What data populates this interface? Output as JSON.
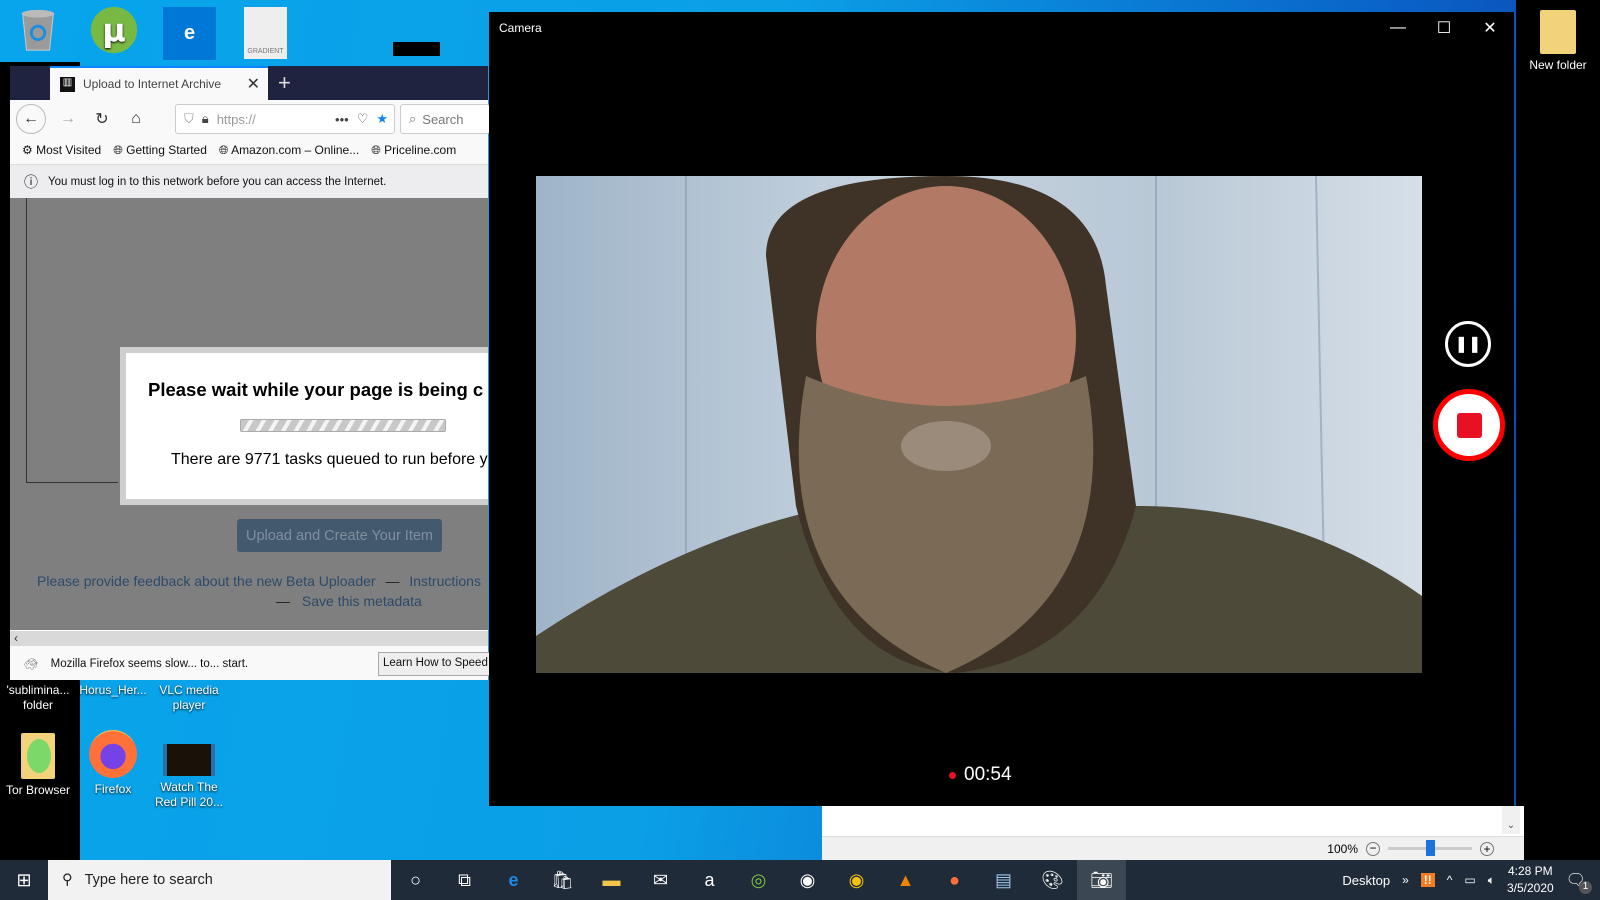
{
  "desktop": {
    "top_icons": [
      {
        "name": "recycle-bin",
        "label": ""
      },
      {
        "name": "utorrent",
        "label": ""
      },
      {
        "name": "edge",
        "label": "e"
      },
      {
        "name": "gradient",
        "label": "GRADIENT"
      }
    ],
    "right_icon": {
      "label": "New folder"
    },
    "bottom_icons": [
      {
        "label": "'sublimina... folder"
      },
      {
        "label": "Horus_Her..."
      },
      {
        "label": "VLC media player"
      },
      {
        "label": "Tor Browser"
      },
      {
        "label": "Firefox"
      },
      {
        "label": "Watch The Red Pill 20..."
      }
    ]
  },
  "firefox": {
    "tab_title": "Upload to Internet Archive",
    "url": "https://",
    "search_placeholder": "Search",
    "bookmarks": [
      "Most Visited",
      "Getting Started",
      "Amazon.com – Online...",
      "Priceline.com"
    ],
    "captive_notice": "You must log in to this network before you can access the Internet.",
    "dialog_title": "Please wait while your page is being c",
    "dialog_text": "There are 9771 tasks queued to run before y",
    "upload_button": "Upload and Create Your Item",
    "feedback_link": "Please provide feedback about the new Beta Uploader",
    "dash": "—",
    "instructions_link": "Instructions",
    "save_link": "Save this metadata",
    "slow_notice": "Mozilla Firefox seems slow... to... start.",
    "learn_button": "Learn How to Speed"
  },
  "camera": {
    "title": "Camera",
    "recording_time": "00:54",
    "record_color": "#e81123"
  },
  "paint": {
    "zoom": "100%"
  },
  "taskbar": {
    "search_placeholder": "Type here to search",
    "desktop_label": "Desktop",
    "time": "4:28 PM",
    "date": "3/5/2020",
    "notifications": "1"
  }
}
